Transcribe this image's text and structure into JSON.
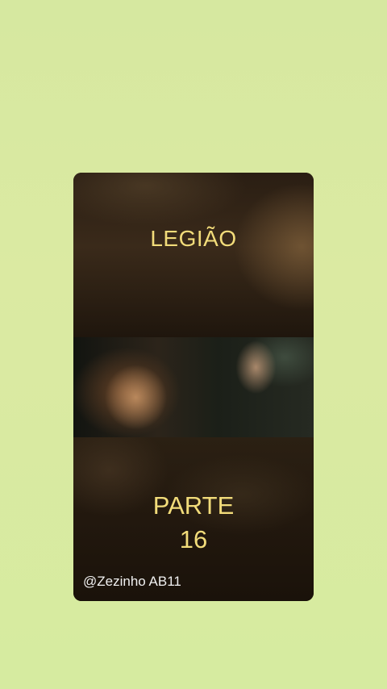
{
  "card": {
    "title": "LEGIÃO",
    "part_label": "PARTE",
    "part_number": "16",
    "handle": "@Zezinho AB11"
  },
  "colors": {
    "background": "#d8ea a2",
    "title_text": "#f2dc7a",
    "handle_text": "#f0f0f0",
    "card_bg": "#1e150e"
  }
}
